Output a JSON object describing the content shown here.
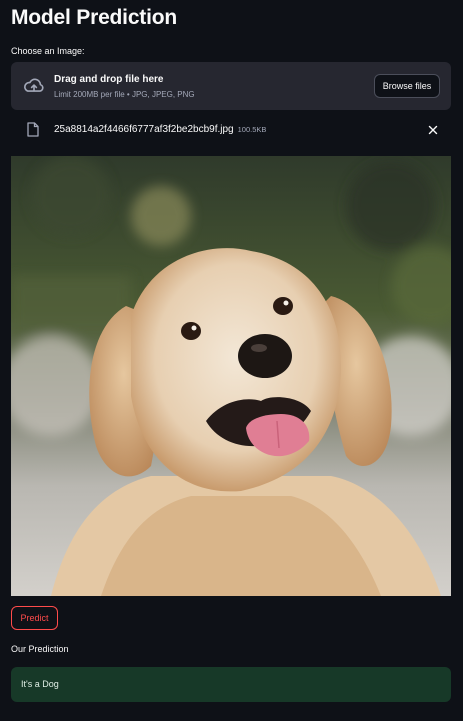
{
  "header": {
    "title": "Model Prediction"
  },
  "uploader": {
    "label": "Choose an Image:",
    "drop_title": "Drag and drop file here",
    "limit_text": "Limit 200MB per file • JPG, JPEG, PNG",
    "browse_label": "Browse files"
  },
  "uploaded_file": {
    "name": "25a8814a2f4466f6777af3f2be2bcb9f.jpg",
    "size": "100.5KB"
  },
  "image": {
    "subject": "golden retriever dog"
  },
  "actions": {
    "predict_label": "Predict"
  },
  "prediction": {
    "heading": "Our Prediction",
    "result": "It's a Dog"
  },
  "colors": {
    "background": "#0e1117",
    "dropzone": "#262730",
    "accent": "#ff4b4b",
    "success_bg": "#173928"
  }
}
